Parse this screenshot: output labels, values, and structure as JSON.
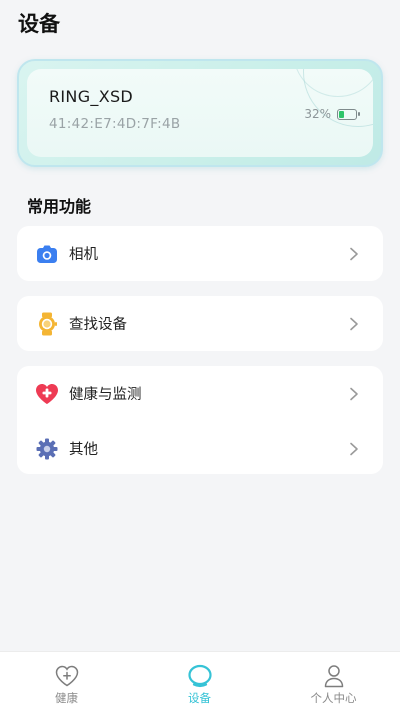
{
  "header": {
    "title": "设备"
  },
  "device": {
    "name": "RING_XSD",
    "mac": "41:42:E7:4D:7F:4B",
    "battery_text": "32%",
    "battery_level": 0.32,
    "battery_color": "#2ec46a"
  },
  "features": {
    "title": "常用功能",
    "camera": {
      "label": "相机",
      "icon": "camera-icon"
    },
    "find_device": {
      "label": "查找设备",
      "icon": "watch-icon"
    },
    "health": {
      "label": "健康与监测",
      "icon": "heart-plus-icon"
    },
    "other": {
      "label": "其他",
      "icon": "gear-icon"
    }
  },
  "tabbar": {
    "tabs": [
      {
        "label": "健康",
        "icon": "heart-icon",
        "active": false
      },
      {
        "label": "设备",
        "icon": "device-icon",
        "active": true
      },
      {
        "label": "个人中心",
        "icon": "person-icon",
        "active": false
      }
    ],
    "active_color": "#36c3d6"
  }
}
